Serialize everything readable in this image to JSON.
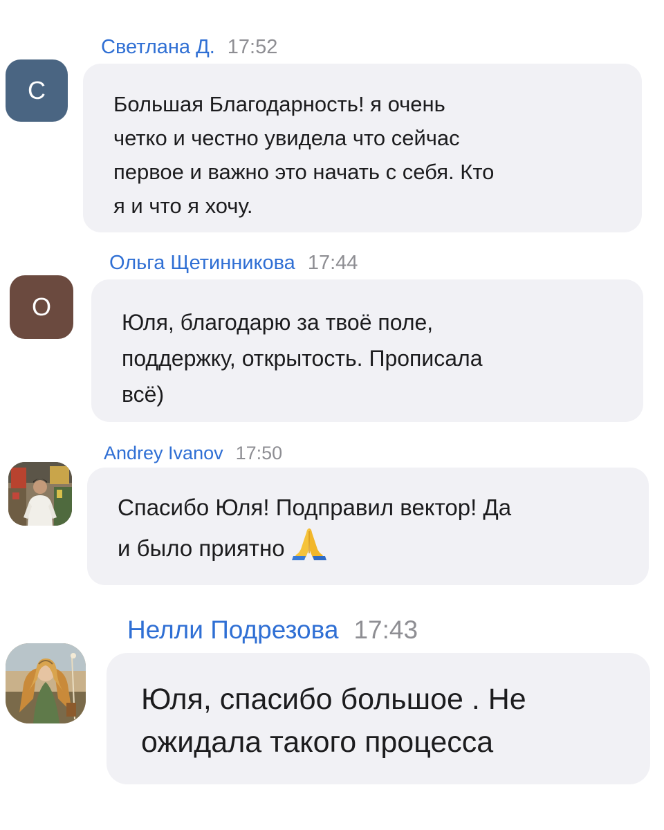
{
  "messages": [
    {
      "author": "Светлана Д.",
      "time": "17:52",
      "avatar": {
        "type": "letter",
        "letter": "С",
        "color": "#4a6582"
      },
      "text": "Большая Благодарность! я очень\nчетко и честно увидела что сейчас\nпервое и важно это начать с себя. Кто\nя и что я хочу."
    },
    {
      "author": "Ольга Щетинникова",
      "time": "17:44",
      "avatar": {
        "type": "letter",
        "letter": "О",
        "color": "#6b4a3f"
      },
      "text": "Юля, благодарю за твоё поле,\nподдержку, открытость. Прописала\nвсё)"
    },
    {
      "author": "Andrey Ivanov",
      "time": "17:50",
      "avatar": {
        "type": "photo",
        "icon": "man-photo-avatar"
      },
      "text": "Спасибо Юля! Подправил вектор! Да\nи было приятно",
      "emoji": "folded-hands-icon"
    },
    {
      "author": "Нелли Подрезова",
      "time": "17:43",
      "avatar": {
        "type": "photo",
        "icon": "painting-photo-avatar"
      },
      "text": "Юля, спасибо большое . Не\nожидала такого процесса"
    }
  ],
  "colors": {
    "author_name": "#2f6fd4",
    "timestamp": "#8e8e93",
    "bubble_bg": "#f1f1f5",
    "text": "#1c1c1e"
  }
}
